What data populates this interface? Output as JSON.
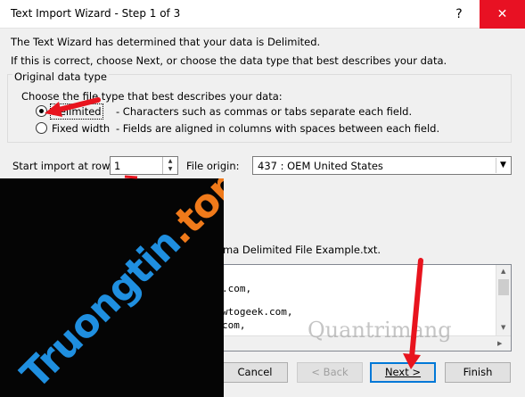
{
  "window": {
    "title": "Text Import Wizard - Step 1 of 3",
    "help": "?",
    "close": "✕"
  },
  "intro": {
    "line1": "The Text Wizard has determined that your data is Delimited.",
    "line2": "If this is correct, choose Next, or choose the data type that best describes your data."
  },
  "datatype": {
    "group_title": "Original data type",
    "prompt": "Choose the file type that best describes your data:",
    "options": [
      {
        "label": "Delimited",
        "desc": "- Characters such as commas or tabs separate each field.",
        "selected": true
      },
      {
        "label": "Fixed width",
        "desc": "- Fields are aligned in columns with spaces between each field.",
        "selected": false
      }
    ]
  },
  "start_row": {
    "label": "Start import at row:",
    "value": "1"
  },
  "file_origin": {
    "label": "File origin:",
    "value": "437 : OEM United States"
  },
  "preview": {
    "caption": "ma Delimited File Example.txt.",
    "lines": [
      ".com,",
      "wtogeek.com,",
      "com,"
    ]
  },
  "buttons": {
    "cancel": "Cancel",
    "back": "< Back",
    "next": "Next >",
    "finish": "Finish"
  },
  "watermark": {
    "main": "Truongtin",
    "tld": ".top",
    "secondary": "Quantrimang"
  },
  "colors": {
    "close_bg": "#e81123",
    "default_btn_border": "#0078d7",
    "arrow": "#e8141e"
  }
}
